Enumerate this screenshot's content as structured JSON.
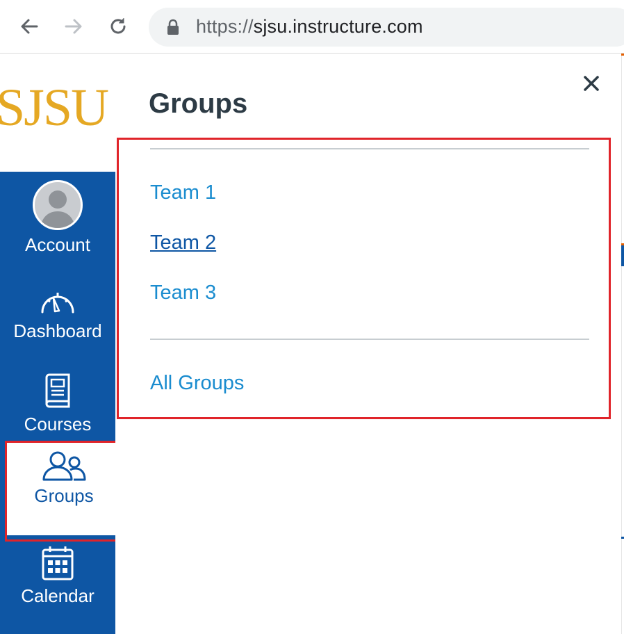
{
  "browser": {
    "url_scheme": "https://",
    "url_host": "sjsu.instructure.com"
  },
  "logo": {
    "text": "SJSU"
  },
  "global_nav": {
    "items": [
      {
        "label": "Account",
        "icon": "avatar"
      },
      {
        "label": "Dashboard",
        "icon": "speedometer-icon"
      },
      {
        "label": "Courses",
        "icon": "book-icon"
      },
      {
        "label": "Groups",
        "icon": "group-icon",
        "active": true
      },
      {
        "label": "Calendar",
        "icon": "calendar-icon"
      }
    ]
  },
  "tray": {
    "title": "Groups",
    "close_label": "×",
    "groups": [
      {
        "label": "Team 1"
      },
      {
        "label": "Team 2",
        "hovered": true
      },
      {
        "label": "Team 3"
      }
    ],
    "all_groups_label": "All Groups"
  },
  "colors": {
    "nav_bg": "#0e56a4",
    "logo": "#e5a823",
    "link": "#1a8ccf",
    "highlight_box": "#e0242a",
    "title": "#2d3b45"
  }
}
